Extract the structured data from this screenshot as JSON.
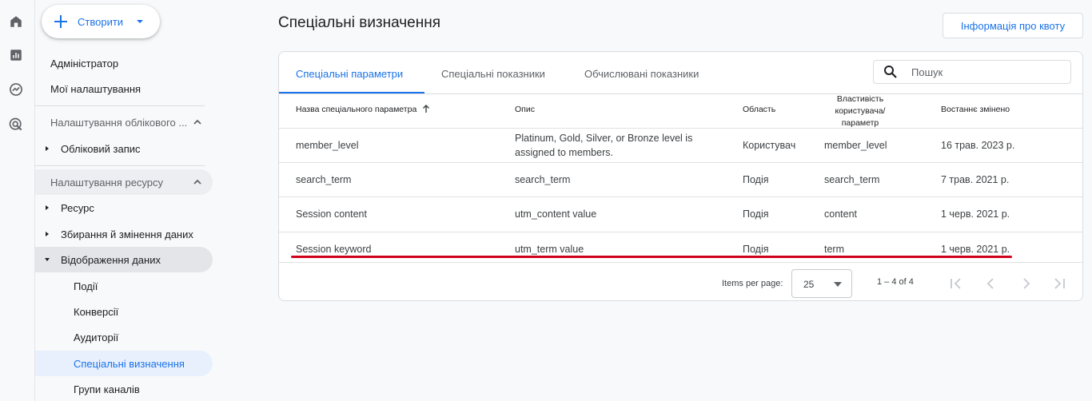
{
  "rail": {
    "icons": [
      "home-icon",
      "reports-icon",
      "explore-icon",
      "advertising-icon"
    ]
  },
  "sidebar": {
    "create_label": "Створити",
    "admin_label": "Адміністратор",
    "my_settings_label": "Мої налаштування",
    "account_section": "Налаштування облікового ...",
    "account_item": "Обліковий запис",
    "property_section": "Налаштування ресурсу",
    "items": [
      {
        "label": "Ресурс"
      },
      {
        "label": "Збирання й змінення даних"
      },
      {
        "label": "Відображення даних"
      }
    ],
    "sub_items": [
      {
        "label": "Події"
      },
      {
        "label": "Конверсії"
      },
      {
        "label": "Аудиторії"
      },
      {
        "label": "Спеціальні визначення"
      },
      {
        "label": "Групи каналів"
      }
    ]
  },
  "main": {
    "title": "Спеціальні визначення",
    "quota_button": "Інформація про квоту",
    "tabs": [
      {
        "label": "Спеціальні параметри"
      },
      {
        "label": "Спеціальні показники"
      },
      {
        "label": "Обчислювані показники"
      }
    ],
    "search_placeholder": "Пошук",
    "table": {
      "headers": {
        "name": "Назва спеціального параметра",
        "description": "Опис",
        "scope": "Область",
        "user_property_1": "Властивість",
        "user_property_2": "користувача/",
        "user_property_3": "параметр",
        "last_changed": "Востаннє змінено"
      },
      "rows": [
        {
          "name": "member_level",
          "desc_1": "Platinum, Gold, Silver, or Bronze level is",
          "desc_2": "assigned to members.",
          "scope": "Користувач",
          "param": "member_level",
          "changed": "16 трав. 2023 р."
        },
        {
          "name": "search_term",
          "desc_1": "search_term",
          "desc_2": "",
          "scope": "Подія",
          "param": "search_term",
          "changed": "7 трав. 2021 р."
        },
        {
          "name": "Session content",
          "desc_1": "utm_content value",
          "desc_2": "",
          "scope": "Подія",
          "param": "content",
          "changed": "1 черв. 2021 р."
        },
        {
          "name": "Session keyword",
          "desc_1": "utm_term value",
          "desc_2": "",
          "scope": "Подія",
          "param": "term",
          "changed": "1 черв. 2021 р."
        }
      ]
    },
    "pagination": {
      "items_per_page_label": "Items per page:",
      "per_page_value": "25",
      "range": "1 – 4 of 4"
    }
  },
  "colors": {
    "accent": "#1a73e8",
    "highlight_line": "#d0021b"
  }
}
